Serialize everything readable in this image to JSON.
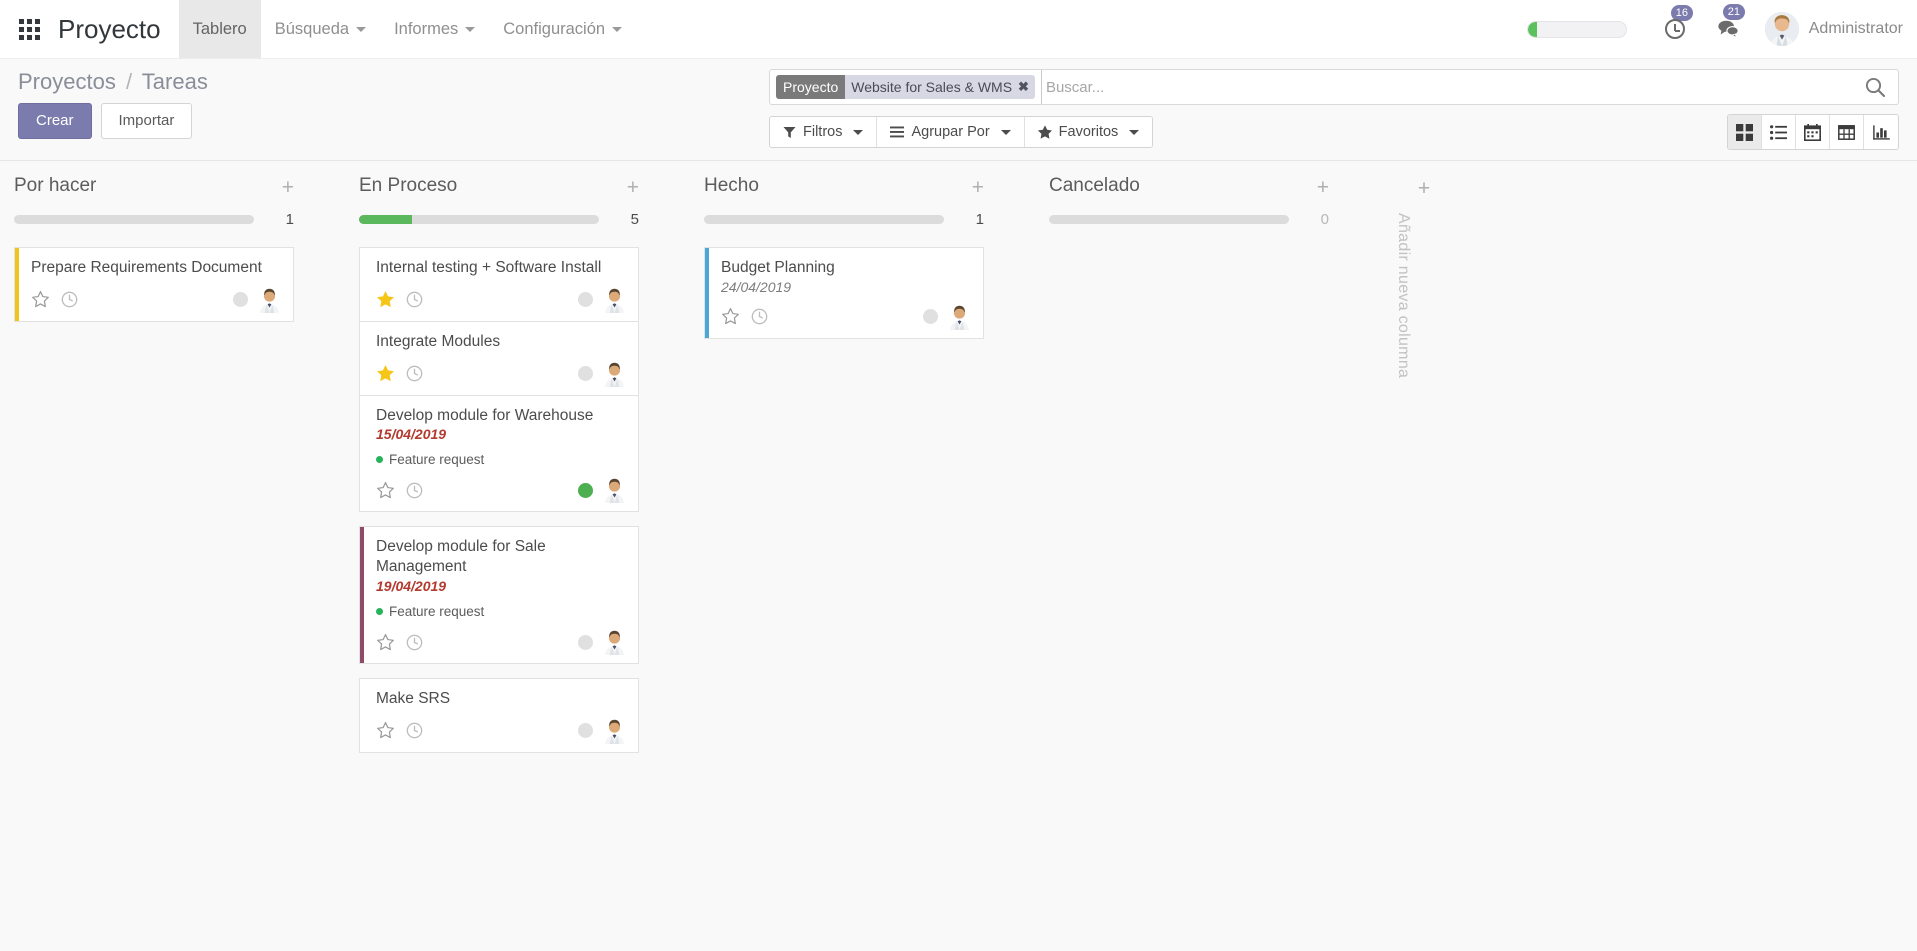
{
  "navbar": {
    "apps_icon": "apps-grid-icon",
    "brand": "Proyecto",
    "menu": [
      {
        "label": "Tablero",
        "active": true,
        "caret": false
      },
      {
        "label": "Búsqueda",
        "active": false,
        "caret": true
      },
      {
        "label": "Informes",
        "active": false,
        "caret": true
      },
      {
        "label": "Configuración",
        "active": false,
        "caret": true
      }
    ],
    "progress_percent": 9,
    "activities": {
      "icon": "clock-icon",
      "count": "16"
    },
    "messages": {
      "icon": "chat-bubble-icon",
      "count": "21"
    },
    "user_name": "Administrator",
    "avatar_icon": "user-avatar"
  },
  "control_panel": {
    "breadcrumb": {
      "parent": "Proyectos",
      "separator": "/",
      "current": "Tareas"
    },
    "create_label": "Crear",
    "import_label": "Importar",
    "search": {
      "facet_label": "Proyecto",
      "facet_value": "Website for Sales & WMS",
      "facet_remove_icon": "close-icon",
      "placeholder": "Buscar...",
      "value": "",
      "search_icon": "search-icon"
    },
    "filters": [
      {
        "label": "Filtros",
        "icon": "funnel-icon",
        "caret": true
      },
      {
        "label": "Agrupar Por",
        "icon": "bars-icon",
        "caret": true
      },
      {
        "label": "Favoritos",
        "icon": "star-icon",
        "caret": true
      }
    ],
    "views": [
      {
        "name": "kanban-view-button",
        "icon": "kanban-icon",
        "active": true
      },
      {
        "name": "list-view-button",
        "icon": "list-icon",
        "active": false
      },
      {
        "name": "calendar-view-button",
        "icon": "calendar-icon",
        "active": false
      },
      {
        "name": "pivot-view-button",
        "icon": "table-icon",
        "active": false
      },
      {
        "name": "graph-view-button",
        "icon": "bar-chart-icon",
        "active": false
      }
    ]
  },
  "kanban": {
    "add_column": {
      "plus": "+",
      "label": "Añadir nueva columna"
    },
    "columns": [
      {
        "title": "Por hacer",
        "plus": "+",
        "count": "1",
        "progress_percent": 0,
        "cards": [
          {
            "title": "Prepare Requirements Document",
            "date": "",
            "date_state": "",
            "tags": [],
            "starred": false,
            "accent_color": "#f0c419",
            "state_color": "#e0e0e0",
            "star_icon": "star-outline-icon",
            "clock_icon": "clock-icon",
            "avatar_icon": "user-avatar"
          }
        ]
      },
      {
        "title": "En Proceso",
        "plus": "+",
        "count": "5",
        "progress_percent": 22,
        "cards": [
          {
            "title": "Internal testing + Software Install",
            "date": "",
            "date_state": "",
            "tags": [],
            "starred": true,
            "accent_color": "",
            "state_color": "#e0e0e0",
            "star_icon": "star-filled-icon",
            "clock_icon": "clock-icon",
            "avatar_icon": "user-avatar"
          },
          {
            "title": "Integrate Modules",
            "date": "",
            "date_state": "",
            "tags": [],
            "starred": true,
            "accent_color": "",
            "state_color": "#e0e0e0",
            "star_icon": "star-filled-icon",
            "clock_icon": "clock-icon",
            "avatar_icon": "user-avatar"
          },
          {
            "title": "Develop module for Warehouse",
            "date": "15/04/2019",
            "date_state": "overdue",
            "tags": [
              {
                "label": "Feature request",
                "color": "#26b35a"
              }
            ],
            "starred": false,
            "accent_color": "",
            "state_color": "#4caf50",
            "star_icon": "star-outline-icon",
            "clock_icon": "clock-icon",
            "avatar_icon": "user-avatar"
          },
          {
            "title": "Develop module for Sale Management",
            "date": "19/04/2019",
            "date_state": "overdue",
            "tags": [
              {
                "label": "Feature request",
                "color": "#26b35a"
              }
            ],
            "starred": false,
            "accent_color": "#8e4a66",
            "state_color": "#e0e0e0",
            "star_icon": "star-outline-icon",
            "clock_icon": "clock-icon",
            "avatar_icon": "user-avatar"
          },
          {
            "title": "Make SRS",
            "date": "",
            "date_state": "",
            "tags": [],
            "starred": false,
            "accent_color": "",
            "state_color": "#e0e0e0",
            "star_icon": "star-outline-icon",
            "clock_icon": "clock-icon",
            "avatar_icon": "user-avatar"
          }
        ]
      },
      {
        "title": "Hecho",
        "plus": "+",
        "count": "1",
        "progress_percent": 0,
        "cards": [
          {
            "title": "Budget Planning",
            "date": "24/04/2019",
            "date_state": "normal",
            "tags": [],
            "starred": false,
            "accent_color": "#4aa8d8",
            "state_color": "#e0e0e0",
            "star_icon": "star-outline-icon",
            "clock_icon": "clock-icon",
            "avatar_icon": "user-avatar"
          }
        ]
      },
      {
        "title": "Cancelado",
        "plus": "+",
        "count": "0",
        "progress_percent": 0,
        "cards": []
      }
    ]
  },
  "colors": {
    "brand_purple": "#7c7bad",
    "progress_green": "#5cb85c",
    "overdue_red": "#b33a2e",
    "star_yellow": "#f5c518"
  }
}
